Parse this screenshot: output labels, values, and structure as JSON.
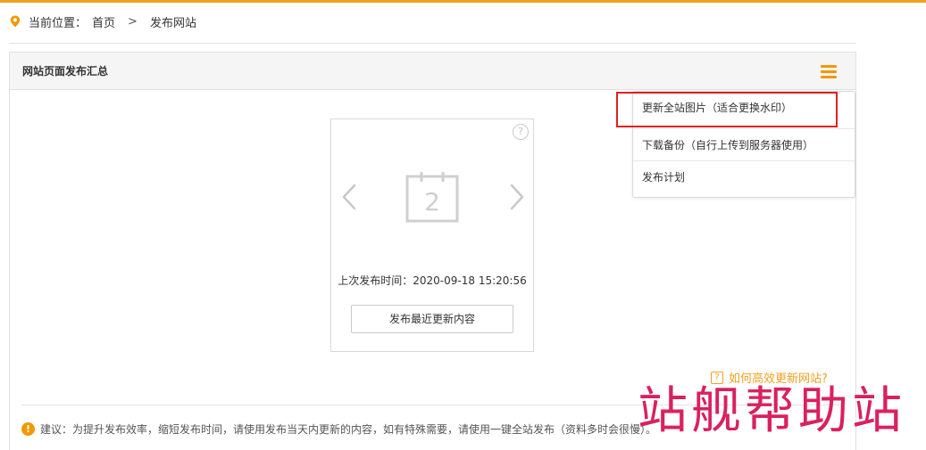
{
  "breadcrumb": {
    "prefix": "当前位置：",
    "home": "首页",
    "separator": ">",
    "current": "发布网站"
  },
  "panel": {
    "title": "网站页面发布汇总"
  },
  "dropdown": {
    "items": [
      {
        "label": "更新全站图片（适合更换水印）",
        "highlighted": true
      },
      {
        "label": "下载备份（自行上传到服务器使用）"
      },
      {
        "label": "发布计划"
      }
    ]
  },
  "card": {
    "help_glyph": "?",
    "calendar_number": "2",
    "last_publish_time": "上次发布时间：2020-09-18 15:20:56",
    "publish_button": "发布最近更新内容"
  },
  "help_link": {
    "label": "如何高效更新网站?"
  },
  "notice": {
    "text": "建议：为提升发布效率，缩短发布时间，请使用发布当天内更新的内容，如有特殊需要，请使用一键全站发布（资料多时会很慢）。"
  },
  "watermark": {
    "text": "站舰帮助站"
  },
  "colors": {
    "accent": "#f39800",
    "highlight": "#e02020",
    "watermark": "#d9215f"
  },
  "icons": {
    "location": "location-pin-icon",
    "menu": "hamburger-menu-icon",
    "help": "question-circle-icon",
    "prev": "chevron-left-icon",
    "next": "chevron-right-icon",
    "calendar": "calendar-icon",
    "warning": "warning-icon"
  }
}
